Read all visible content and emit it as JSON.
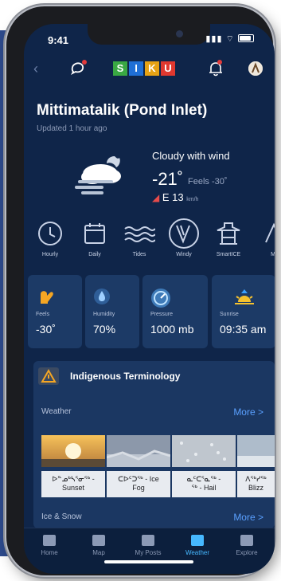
{
  "status": {
    "time": "9:41"
  },
  "header": {
    "back": "‹",
    "logo": [
      {
        "letter": "S",
        "color": "#3aa843"
      },
      {
        "letter": "I",
        "color": "#1f6fd6"
      },
      {
        "letter": "K",
        "color": "#e6a214"
      },
      {
        "letter": "U",
        "color": "#e0382f"
      }
    ]
  },
  "location": {
    "name": "Mittimatalik (Pond Inlet)",
    "updated": "Updated 1 hour ago"
  },
  "weather": {
    "condition": "Cloudy with wind",
    "temp": "-21˚",
    "feels": "Feels -30˚",
    "wind_dir_icon": "wind-arrow-icon",
    "wind": "E 13",
    "wind_unit": "km/h"
  },
  "icon_row": [
    {
      "label": "Hourly",
      "icon": "clock-icon"
    },
    {
      "label": "Daily",
      "icon": "calendar-icon"
    },
    {
      "label": "Tides",
      "icon": "tides-icon"
    },
    {
      "label": "Windy",
      "icon": "windy-icon"
    },
    {
      "label": "SmartICE",
      "icon": "smartice-icon"
    },
    {
      "label": "M",
      "icon": "more-icon"
    }
  ],
  "cards": [
    {
      "label": "Feels",
      "value": "-30˚",
      "icon": "mitten-icon"
    },
    {
      "label": "Humidity",
      "value": "70%",
      "icon": "drop-icon"
    },
    {
      "label": "Pressure",
      "value": "1000 mb",
      "icon": "gauge-icon"
    },
    {
      "label": "Sunrise",
      "value": "09:35 am",
      "icon": "sunrise-icon"
    }
  ],
  "terms": {
    "title": "Indigenous Terminology",
    "weather_label": "Weather",
    "more": "More >",
    "tiles": [
      {
        "caption": "ᐅᓐᓄᒃᓴᕐᓂᖅ -",
        "caption2": "Sunset",
        "color": "#f2b24a"
      },
      {
        "caption": "ᑕᐅᑦᑐᖅ - Ice",
        "caption2": "Fog",
        "color": "#9aa6b8"
      },
      {
        "caption": "ᓇᑦᑕᕐᓇᖅ -",
        "caption2": "ᖅ - Hail",
        "color": "#c9cfd6"
      },
      {
        "caption": "ᐱᖅᓯᖅ",
        "caption2": "Blizz",
        "color": "#b5c2d0"
      }
    ],
    "ice_label": "Ice & Snow",
    "more2": "More >"
  },
  "tabs": [
    {
      "label": "Home",
      "active": false
    },
    {
      "label": "Map",
      "active": false
    },
    {
      "label": "My Posts",
      "active": false
    },
    {
      "label": "Weather",
      "active": true
    },
    {
      "label": "Explore",
      "active": false
    }
  ]
}
